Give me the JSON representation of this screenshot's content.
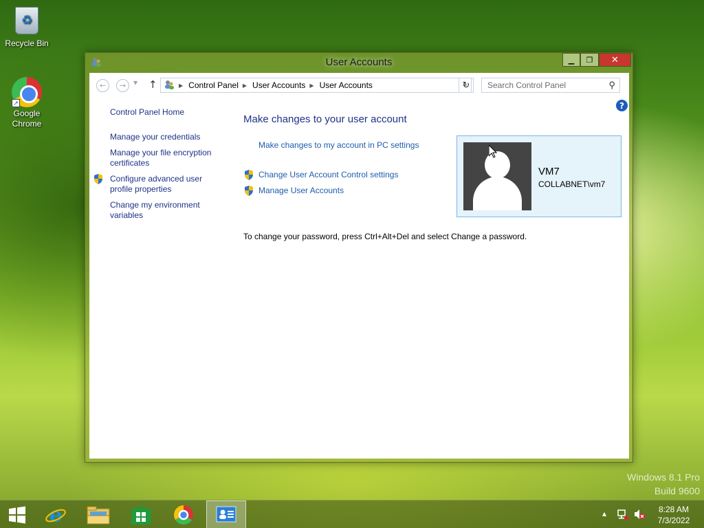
{
  "desktop": {
    "icons": [
      {
        "label": "Recycle Bin"
      },
      {
        "label": "Google Chrome"
      }
    ]
  },
  "window": {
    "title": "User Accounts",
    "controls": {
      "minimize": "▁",
      "maximize": "❐",
      "close": "✕"
    }
  },
  "address_bar": {
    "segments": [
      "Control Panel",
      "User Accounts",
      "User Accounts"
    ],
    "search_placeholder": "Search Control Panel"
  },
  "left_nav": {
    "items": [
      {
        "label": "Control Panel Home",
        "shield": false
      },
      {
        "label": "Manage your credentials",
        "shield": false
      },
      {
        "label": "Manage your file encryption certificates",
        "shield": false
      },
      {
        "label": "Configure advanced user profile properties",
        "shield": true
      },
      {
        "label": "Change my environment variables",
        "shield": false
      }
    ]
  },
  "main": {
    "title": "Make changes to your user account",
    "links": {
      "pc_settings": "Make changes to my account in PC settings",
      "uac_settings": "Change User Account Control settings",
      "manage_accounts": "Manage User Accounts"
    },
    "password_note": "To change your password, press Ctrl+Alt+Del and select Change a password."
  },
  "user": {
    "name": "VM7",
    "domain": "COLLABNET\\vm7"
  },
  "watermark": {
    "line1": "Windows 8.1 Pro",
    "line2": "Build 9600"
  },
  "taskbar": {
    "time": "8:28 AM",
    "date": "7/3/2022"
  },
  "colors": {
    "link": "#1d5dac",
    "heading": "#1e3287",
    "close_button": "#c7372f",
    "user_tile_bg": "#e5f3fb"
  }
}
